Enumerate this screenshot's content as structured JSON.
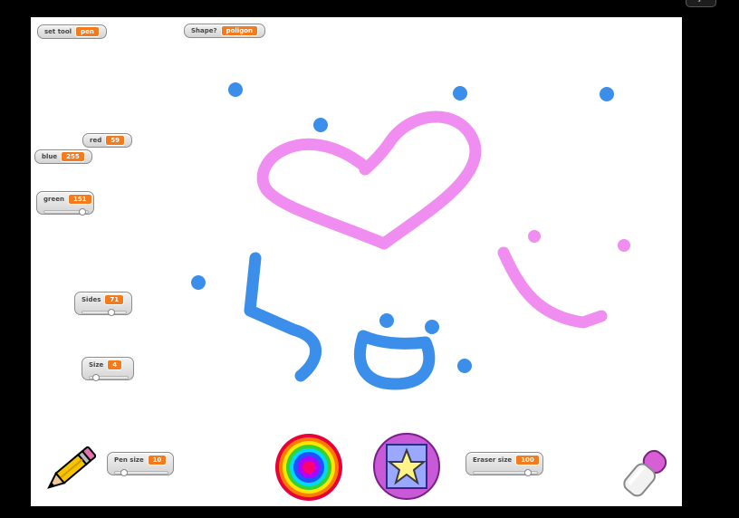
{
  "monitors": {
    "tool": {
      "label": "set tool",
      "value": "pen"
    },
    "shape": {
      "label": "Shape?",
      "value": "poligon"
    },
    "red": {
      "label": "red",
      "value": "59"
    },
    "blue": {
      "label": "blue",
      "value": "255"
    },
    "green": {
      "label": "green",
      "value": "151"
    },
    "sides": {
      "label": "Sides",
      "value": "71"
    },
    "size": {
      "label": "Size",
      "value": "4"
    },
    "pen_size": {
      "label": "Pen size",
      "value": "10"
    },
    "eraser_size": {
      "label": "Eraser size",
      "value": "100"
    }
  },
  "sprites": {
    "pencil": "pencil-icon",
    "color_wheel": "color-wheel-icon",
    "shape_stamp": "star-stamp-icon",
    "eraser": "eraser-icon"
  },
  "colors": {
    "stage_bg": "#ffffff",
    "pink_ink": "#ef8ef0",
    "blue_ink": "#3b8fea",
    "monitor_value": "#f57a1c"
  }
}
